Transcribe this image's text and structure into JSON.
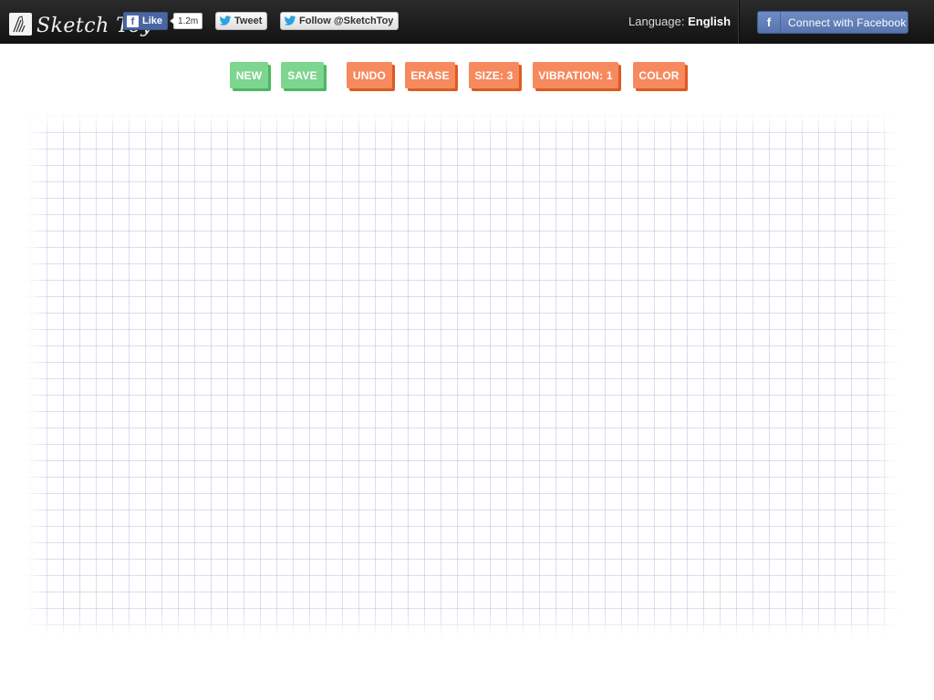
{
  "header": {
    "logo_text": "Sketch Toy",
    "fb_like_label": "Like",
    "fb_like_count": "1.2m",
    "tweet_label": "Tweet",
    "follow_label": "Follow @SketchToy",
    "language_label": "Language:",
    "language_value": "English",
    "connect_label": "Connect with Facebook",
    "connect_icon": "f"
  },
  "toolbar": {
    "new_label": "NEW",
    "save_label": "SAVE",
    "undo_label": "UNDO",
    "erase_label": "ERASE",
    "size_label": "SIZE: 3",
    "vibration_label": "VIBRATION: 1",
    "color_label": "COLOR"
  },
  "icons": {
    "logo": "sketch-logo-icon",
    "facebook": "facebook-icon",
    "twitter": "twitter-bird-icon"
  },
  "colors": {
    "topbar": "#1d1d1d",
    "green_button": "#7dd68f",
    "orange_button": "#f68a5e",
    "facebook_blue": "#5874ad",
    "grid_line": "#b9c3e1"
  }
}
